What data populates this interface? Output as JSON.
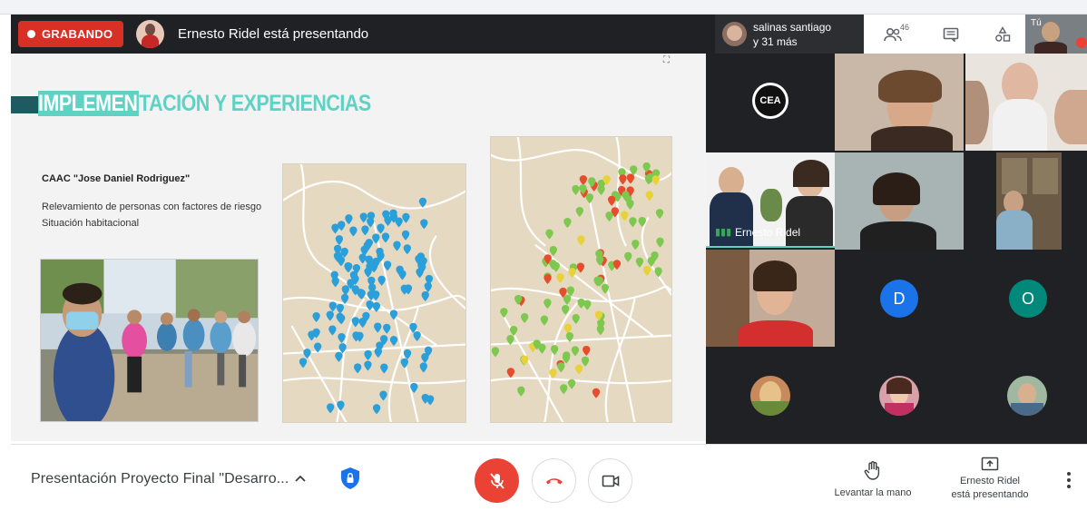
{
  "topbar": {
    "recording_label": "GRABANDO",
    "presenter_text": "Ernesto Ridel está presentando",
    "participants_chip": {
      "line1": "salinas santiago",
      "line2": "y 31 más"
    },
    "people_count": "46",
    "self_label": "Tú",
    "icons": [
      "people-icon",
      "chat-icon",
      "activities-icon"
    ]
  },
  "slide": {
    "title_highlight": "IMPLEMEN",
    "title_rest": "TACIÓN Y EXPERIENCIAS",
    "caac": "CAAC \"Jose Daniel Rodriguez\"",
    "desc1": "Relevamiento de personas con factores de riesgo",
    "desc2": "Situación habitacional"
  },
  "grid": {
    "speaker_name": "Ernesto Ridel",
    "letter_d": "D",
    "letter_o": "O",
    "colors": {
      "d": "#1a73e8",
      "o": "#00897b"
    }
  },
  "bottom": {
    "meeting_title": "Presentación Proyecto Final \"Desarro...",
    "raise_hand": "Levantar la mano",
    "presenting_line1": "Ernesto Ridel",
    "presenting_line2": "está presentando"
  },
  "colors": {
    "recording": "#d93025",
    "mic_off": "#ea4335",
    "teal_title": "#5fd2c4",
    "topbar_bg": "#202124",
    "pin_blue": "#2b9fd9",
    "pin_green": "#7ec850"
  }
}
